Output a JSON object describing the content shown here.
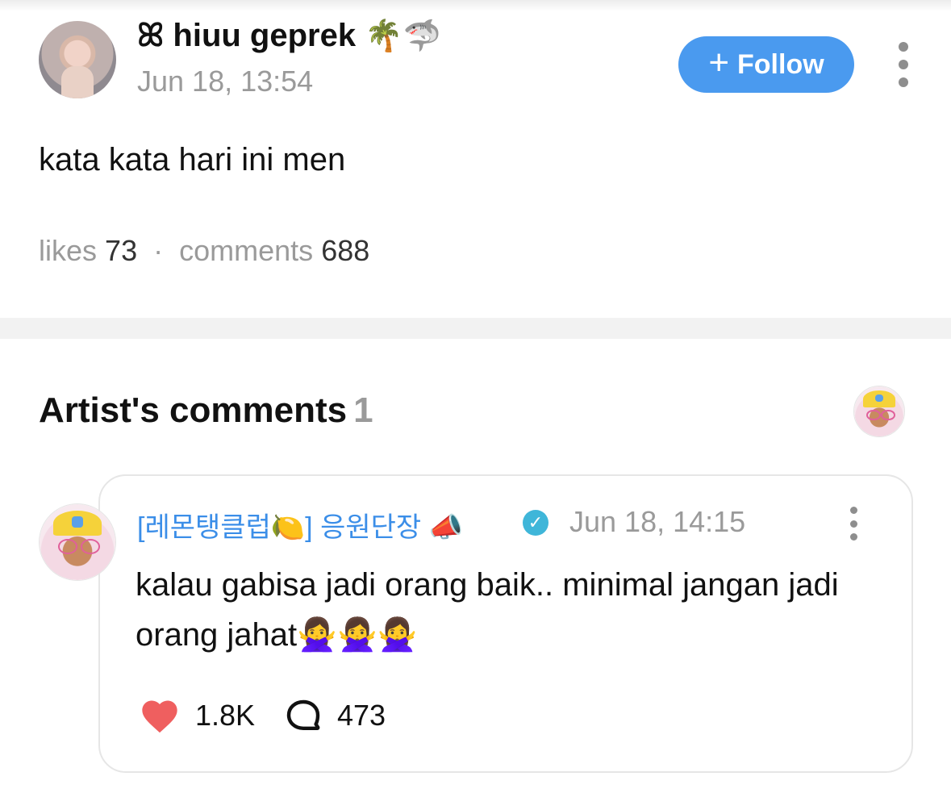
{
  "post": {
    "author_prefix": "ꕤ",
    "author_name": "hiuu geprek",
    "author_emojis": "🌴🦈",
    "timestamp": "Jun 18, 13:54",
    "follow_label": "Follow",
    "follow_plus": "+",
    "body": "kata kata hari ini men",
    "likes_label": "likes",
    "likes_count": "73",
    "separator": "·",
    "comments_label": "comments",
    "comments_count": "688"
  },
  "artist_section": {
    "title": "Artist's comments",
    "count": "1"
  },
  "comment": {
    "author": "[레몬탱클럽🍋] 응원단장 📣",
    "verified_glyph": "✓",
    "timestamp": "Jun 18, 14:15",
    "text": "kalau gabisa jadi orang baik.. minimal jangan jadi orang jahat🙅‍♀️🙅‍♀️🙅‍♀️",
    "like_count": "1.8K",
    "reply_count": "473"
  },
  "colors": {
    "accent": "#4a9aef",
    "commenter": "#3b8ee8",
    "verified": "#3fb6d9",
    "heart": "#ef5f5f",
    "muted": "#9a9a9a",
    "divider": "#f2f2f2"
  },
  "icons": {
    "more": "more-vertical-icon",
    "verified": "verified-badge-icon",
    "like": "heart-icon",
    "reply": "comment-bubble-icon"
  }
}
